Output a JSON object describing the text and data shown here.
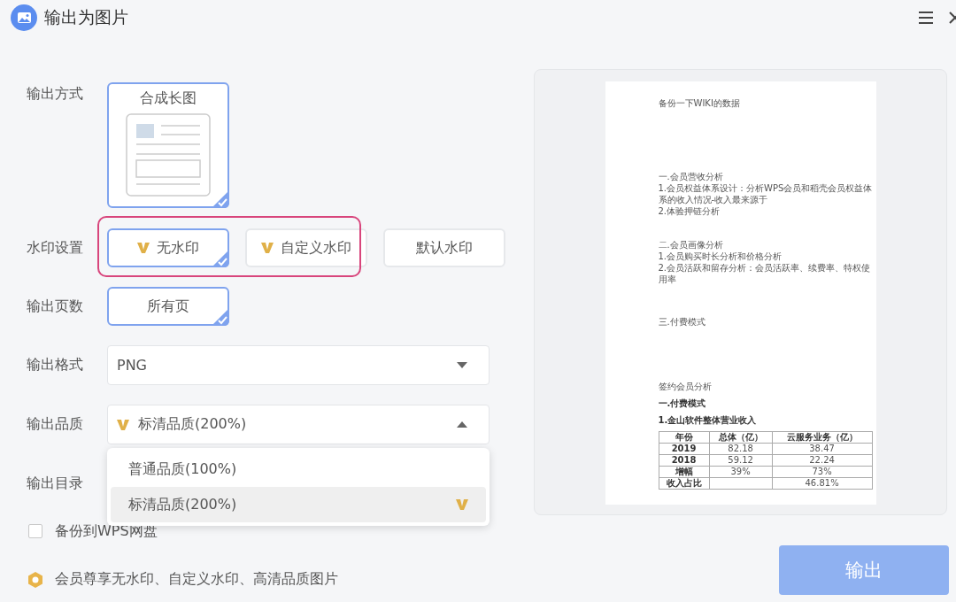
{
  "window": {
    "title": "输出为图片"
  },
  "form": {
    "output_mode": {
      "label": "输出方式",
      "options": [
        {
          "label": "合成长图",
          "selected": true
        }
      ]
    },
    "watermark": {
      "label": "水印设置",
      "options": [
        {
          "label": "无水印",
          "vip": true,
          "selected": true
        },
        {
          "label": "自定义水印",
          "vip": true,
          "selected": false
        },
        {
          "label": "默认水印",
          "vip": false,
          "selected": false
        }
      ]
    },
    "pages": {
      "label": "输出页数",
      "options": [
        {
          "label": "所有页",
          "selected": true
        }
      ]
    },
    "format": {
      "label": "输出格式",
      "value": "PNG",
      "expanded": false
    },
    "quality": {
      "label": "输出品质",
      "value": "标清品质(200%)",
      "vip": true,
      "expanded": true,
      "options": [
        {
          "label": "普通品质(100%)",
          "vip": false,
          "selected": false
        },
        {
          "label": "标清品质(200%)",
          "vip": true,
          "selected": true
        }
      ]
    },
    "directory": {
      "label": "输出目录"
    },
    "backup": {
      "label": "备份到WPS网盘",
      "checked": false
    }
  },
  "member_note": "会员尊享无水印、自定义水印、高清品质图片",
  "preview": {
    "sections": [
      [
        {
          "text": "备份一下WIKI的数据",
          "bold": false
        }
      ],
      [
        {
          "text": "一.会员营收分析",
          "bold": false
        },
        {
          "text": "1.会员权益体系设计：分析WPS会员和稻壳会员权益体系的收入情况-收入最来源于",
          "bold": false
        },
        {
          "text": "2.体验押链分析",
          "bold": false
        }
      ],
      [
        {
          "text": "二.会员画像分析",
          "bold": false
        },
        {
          "text": "1.会员购买时长分析和价格分析",
          "bold": false
        },
        {
          "text": "2.会员活跃和留存分析：会员活跃率、续费率、特权使用率",
          "bold": false
        }
      ],
      [
        {
          "text": "三.付费模式",
          "bold": false
        }
      ],
      [
        {
          "text": "签约会员分析",
          "bold": false
        }
      ],
      [
        {
          "text": "一.付费模式",
          "bold": true
        }
      ],
      [
        {
          "text": "1.金山软件整体营业收入",
          "bold": true
        }
      ]
    ],
    "table": {
      "columns": [
        "年份",
        "总体（亿）",
        "云服务业务（亿）"
      ],
      "rows": [
        [
          "2019",
          "82.18",
          "38.47"
        ],
        [
          "2018",
          "59.12",
          "22.24"
        ],
        [
          "增幅",
          "39%",
          "73%"
        ],
        [
          "收入占比",
          null,
          "46.81%"
        ]
      ]
    }
  },
  "export_button": "输出"
}
